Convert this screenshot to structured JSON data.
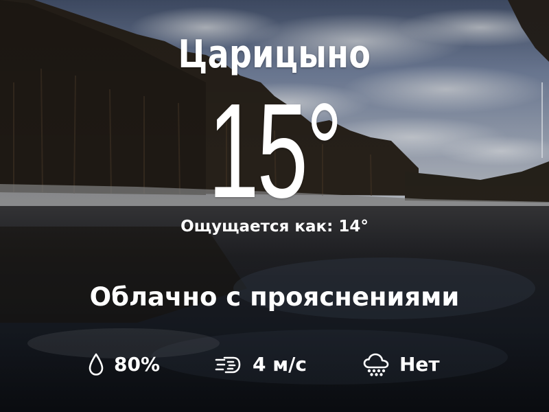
{
  "location": "Царицыно",
  "temperature": "15°",
  "feels_like": "Ощущается как: 14°",
  "condition": "Облачно с прояснениями",
  "stats": {
    "humidity": {
      "icon": "raindrop-icon",
      "value": "80%"
    },
    "wind": {
      "icon": "wind-icon",
      "value": "4 м/с"
    },
    "precipitation": {
      "icon": "cloud-hail-icon",
      "value": "Нет"
    }
  },
  "colors": {
    "text": "#ffffff",
    "sky_light": "#c4cbd6",
    "sky_blue": "#6f83a8",
    "trees": "#2a2219",
    "water": "#151a22"
  }
}
